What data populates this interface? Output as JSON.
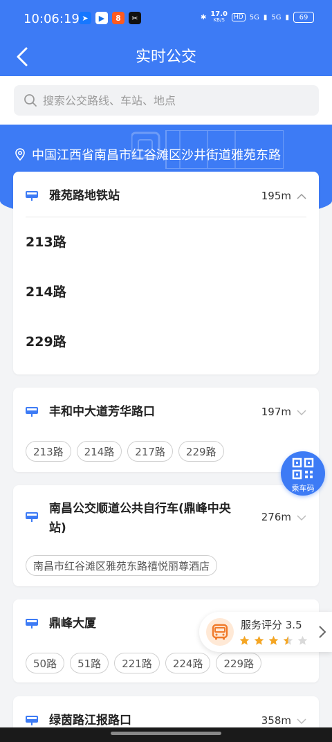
{
  "status_bar": {
    "time": "10:06:19",
    "net_speed": "17.0",
    "net_unit": "KB/S",
    "hd": "HD",
    "signal_1": "5G",
    "signal_2": "5G",
    "battery": "69"
  },
  "header": {
    "title": "实时公交"
  },
  "search": {
    "placeholder": "搜索公交路线、车站、地点"
  },
  "location": "中国江西省南昌市红谷滩区沙井街道雅苑东路",
  "stops": [
    {
      "name": "雅苑路地铁站",
      "distance": "195m",
      "expanded": true,
      "routes": [
        "213路",
        "214路",
        "229路"
      ]
    },
    {
      "name": "丰和中大道芳华路口",
      "distance": "197m",
      "routes": [
        "213路",
        "214路",
        "217路",
        "229路"
      ]
    },
    {
      "name_line1": "南昌公交顺道公共自行车(鼎峰中央",
      "name_line2": "站)",
      "distance": "276m",
      "routes": [
        "南昌市红谷滩区雅苑东路禧悦丽尊酒店"
      ]
    },
    {
      "name": "鼎峰大厦",
      "routes": [
        "50路",
        "51路",
        "221路",
        "224路",
        "229路"
      ]
    },
    {
      "name": "绿茵路江报路口",
      "distance": "358m"
    }
  ],
  "qr": {
    "label": "乘车码"
  },
  "rating": {
    "label": "服务评分 3.5",
    "value": 3.5,
    "max": 5
  },
  "colors": {
    "primary": "#3d7bf5",
    "star": "#f5a623",
    "star_empty": "#d9d9d9"
  }
}
